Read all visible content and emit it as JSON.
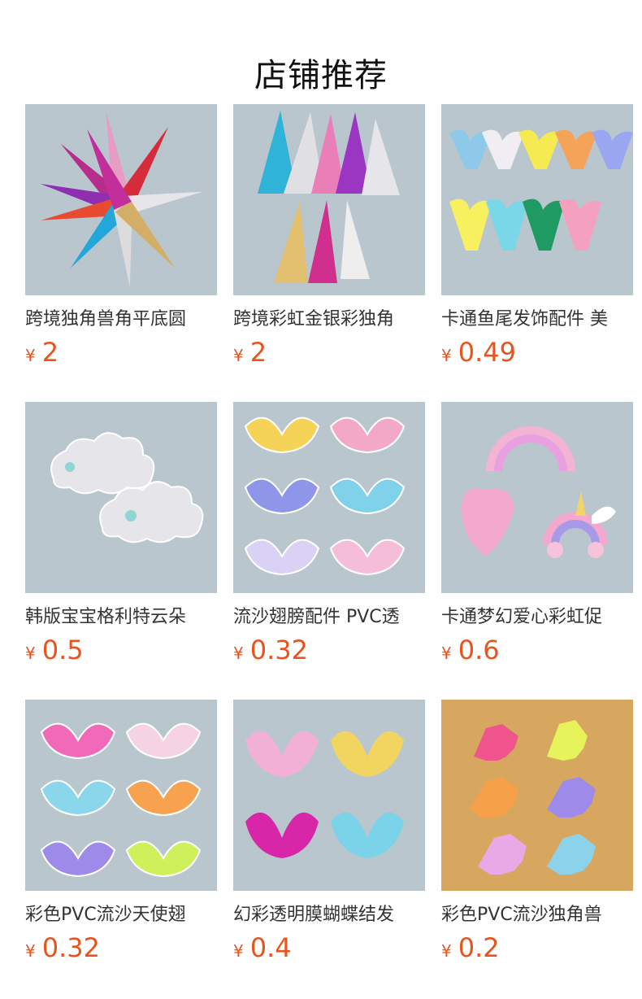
{
  "section": {
    "title": "店铺推荐"
  },
  "currency_symbol": "¥",
  "colors": {
    "price": "#e8541e",
    "photo_background": "#b9c6ce",
    "photo_background_warm": "#d7a760"
  },
  "products": [
    {
      "name": "跨境独角兽角平底圆",
      "price": "2",
      "image_icon": "unicorn-horns-photo"
    },
    {
      "name": "跨境彩虹金银彩独角",
      "price": "2",
      "image_icon": "rainbow-unicorn-horns-photo"
    },
    {
      "name": "卡通鱼尾发饰配件 美",
      "price": "0.49",
      "image_icon": "mermaid-tails-photo"
    },
    {
      "name": "韩版宝宝格利特云朵",
      "price": "0.5",
      "image_icon": "glitter-clouds-photo"
    },
    {
      "name": "流沙翅膀配件 PVC透",
      "price": "0.32",
      "image_icon": "sequin-wings-photo"
    },
    {
      "name": "卡通梦幻爱心彩虹促",
      "price": "0.6",
      "image_icon": "heart-rainbow-photo"
    },
    {
      "name": "彩色PVC流沙天使翅",
      "price": "0.32",
      "image_icon": "angel-wings-photo"
    },
    {
      "name": "幻彩透明膜蝴蝶结发",
      "price": "0.4",
      "image_icon": "iridescent-bows-photo"
    },
    {
      "name": "彩色PVC流沙独角兽",
      "price": "0.2",
      "image_icon": "unicorn-figures-photo"
    }
  ]
}
